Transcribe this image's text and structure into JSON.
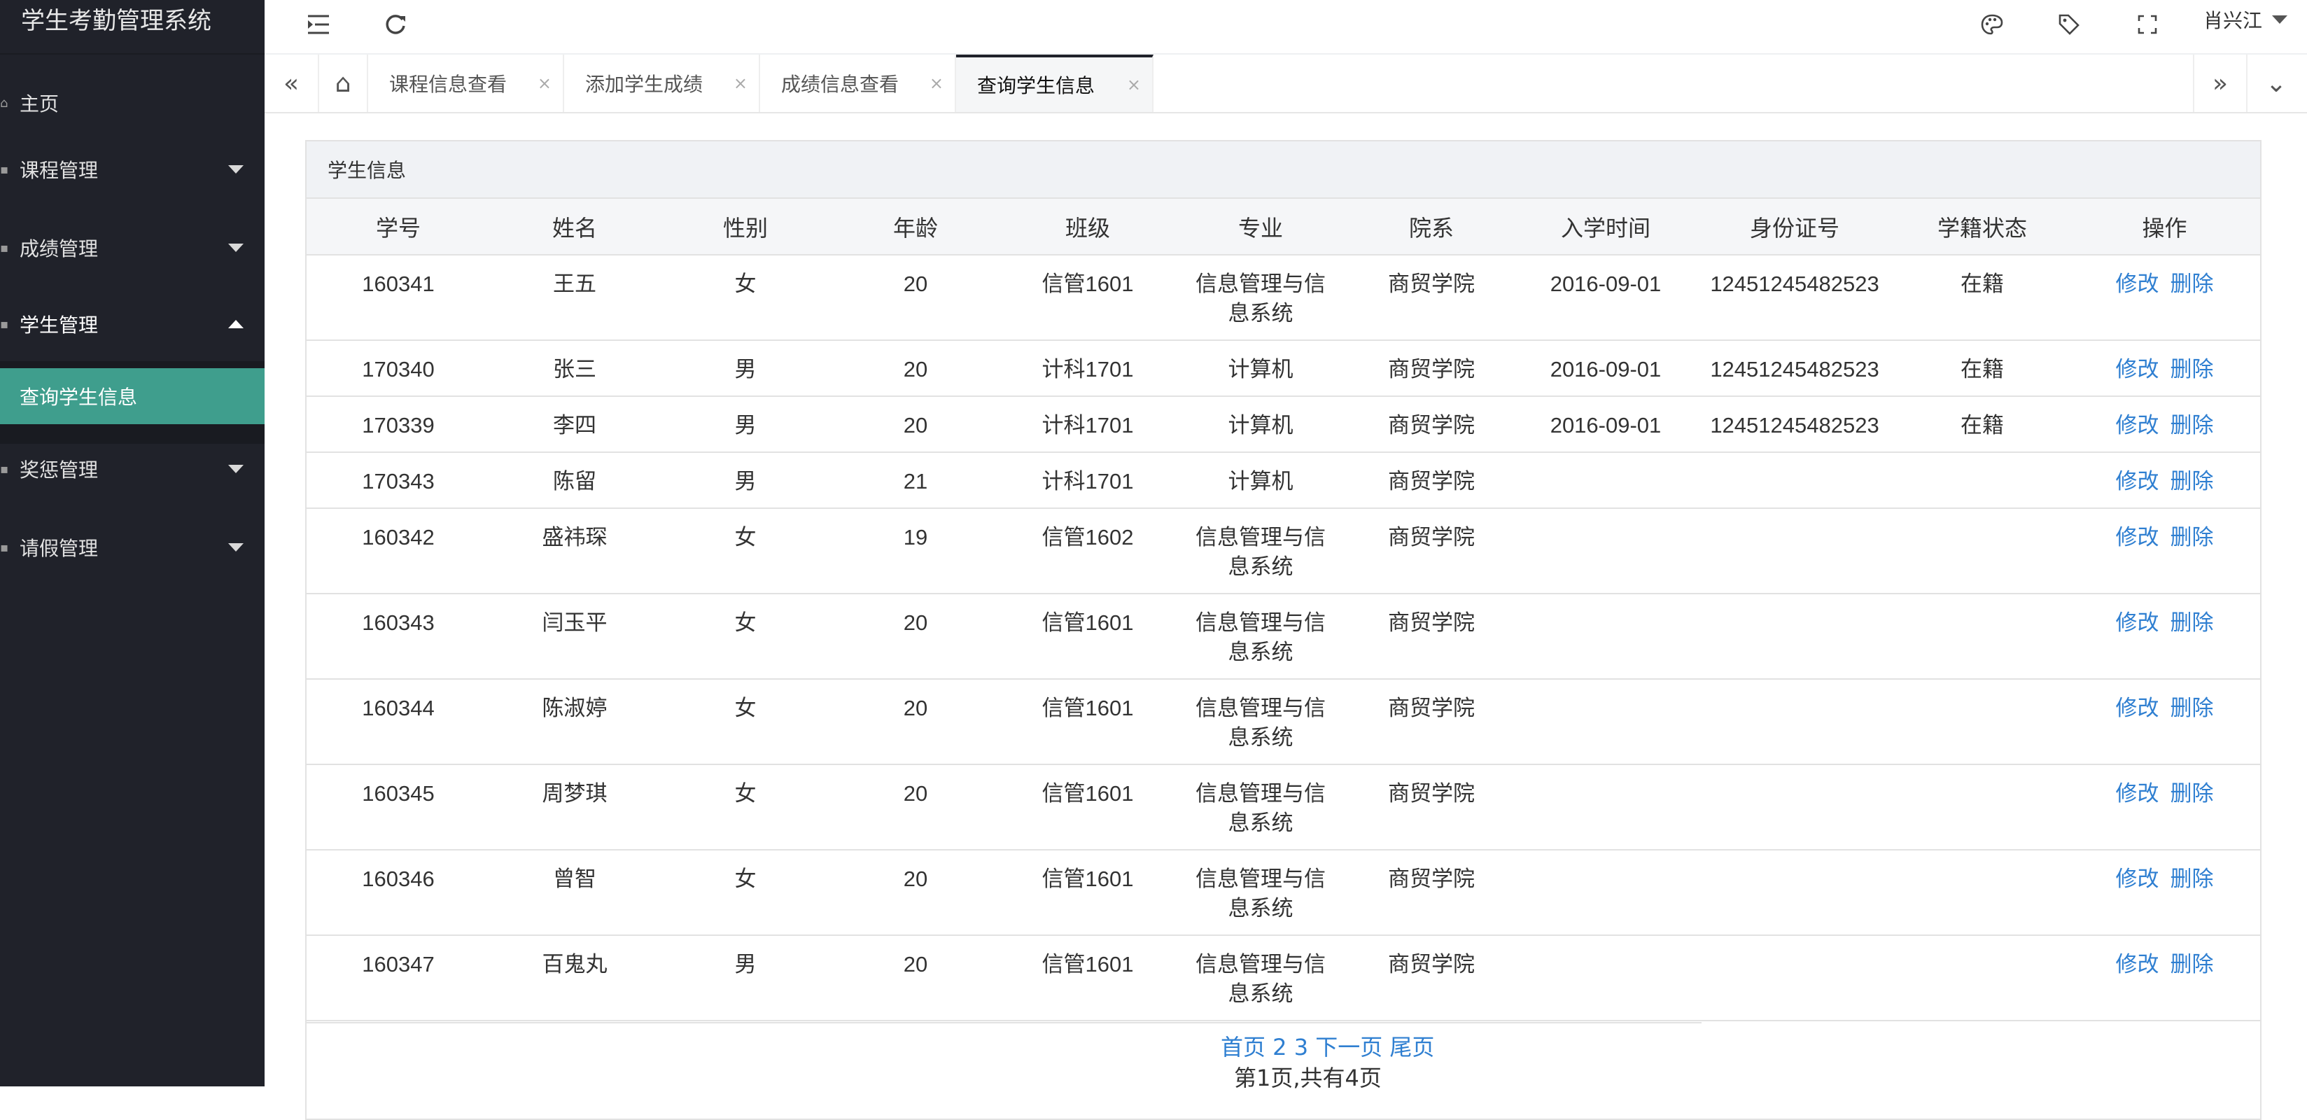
{
  "app_title": "学生考勤管理系统",
  "sidebar": {
    "items": [
      {
        "label": "主页",
        "has_arrow": false
      },
      {
        "label": "课程管理",
        "has_arrow": true
      },
      {
        "label": "成绩管理",
        "has_arrow": true
      },
      {
        "label": "学生管理",
        "has_arrow": true,
        "open": true
      },
      {
        "label": "奖惩管理",
        "has_arrow": true
      },
      {
        "label": "请假管理",
        "has_arrow": true
      }
    ],
    "active_subitem": "查询学生信息"
  },
  "header": {
    "user_name": "肖兴江"
  },
  "tabs": [
    {
      "label": "课程信息查看"
    },
    {
      "label": "添加学生成绩"
    },
    {
      "label": "成绩信息查看"
    },
    {
      "label": "查询学生信息",
      "active": true
    }
  ],
  "panel": {
    "title": "学生信息",
    "columns": [
      "学号",
      "姓名",
      "性别",
      "年龄",
      "班级",
      "专业",
      "院系",
      "入学时间",
      "身份证号",
      "学籍状态",
      "操作"
    ],
    "rows": [
      {
        "id": "160341",
        "name": "王五",
        "sex": "女",
        "age": "20",
        "class": "信管1601",
        "major1": "信息管理与信",
        "major2": "息系统",
        "dept": "商贸学院",
        "enroll": "2016-09-01",
        "idcard": "12451245482523",
        "status": "在籍"
      },
      {
        "id": "170340",
        "name": "张三",
        "sex": "男",
        "age": "20",
        "class": "计科1701",
        "major1": "计算机",
        "major2": "",
        "dept": "商贸学院",
        "enroll": "2016-09-01",
        "idcard": "12451245482523",
        "status": "在籍"
      },
      {
        "id": "170339",
        "name": "李四",
        "sex": "男",
        "age": "20",
        "class": "计科1701",
        "major1": "计算机",
        "major2": "",
        "dept": "商贸学院",
        "enroll": "2016-09-01",
        "idcard": "12451245482523",
        "status": "在籍"
      },
      {
        "id": "170343",
        "name": "陈留",
        "sex": "男",
        "age": "21",
        "class": "计科1701",
        "major1": "计算机",
        "major2": "",
        "dept": "商贸学院",
        "enroll": "",
        "idcard": "",
        "status": ""
      },
      {
        "id": "160342",
        "name": "盛祎琛",
        "sex": "女",
        "age": "19",
        "class": "信管1602",
        "major1": "信息管理与信",
        "major2": "息系统",
        "dept": "商贸学院",
        "enroll": "",
        "idcard": "",
        "status": ""
      },
      {
        "id": "160343",
        "name": "闫玉平",
        "sex": "女",
        "age": "20",
        "class": "信管1601",
        "major1": "信息管理与信",
        "major2": "息系统",
        "dept": "商贸学院",
        "enroll": "",
        "idcard": "",
        "status": ""
      },
      {
        "id": "160344",
        "name": "陈淑婷",
        "sex": "女",
        "age": "20",
        "class": "信管1601",
        "major1": "信息管理与信",
        "major2": "息系统",
        "dept": "商贸学院",
        "enroll": "",
        "idcard": "",
        "status": ""
      },
      {
        "id": "160345",
        "name": "周梦琪",
        "sex": "女",
        "age": "20",
        "class": "信管1601",
        "major1": "信息管理与信",
        "major2": "息系统",
        "dept": "商贸学院",
        "enroll": "",
        "idcard": "",
        "status": ""
      },
      {
        "id": "160346",
        "name": "曾智",
        "sex": "女",
        "age": "20",
        "class": "信管1601",
        "major1": "信息管理与信",
        "major2": "息系统",
        "dept": "商贸学院",
        "enroll": "",
        "idcard": "",
        "status": ""
      },
      {
        "id": "160347",
        "name": "百鬼丸",
        "sex": "男",
        "age": "20",
        "class": "信管1601",
        "major1": "信息管理与信",
        "major2": "息系统",
        "dept": "商贸学院",
        "enroll": "",
        "idcard": "",
        "status": ""
      }
    ],
    "action_edit": "修改",
    "action_delete": "删除"
  },
  "pager": {
    "links": "首页 2 3 下一页 尾页",
    "info": "第1页,共有4页"
  },
  "colors": {
    "sidebar_bg": "#20222a",
    "active_item": "#3f9e8d",
    "link": "#2f7fd1"
  }
}
